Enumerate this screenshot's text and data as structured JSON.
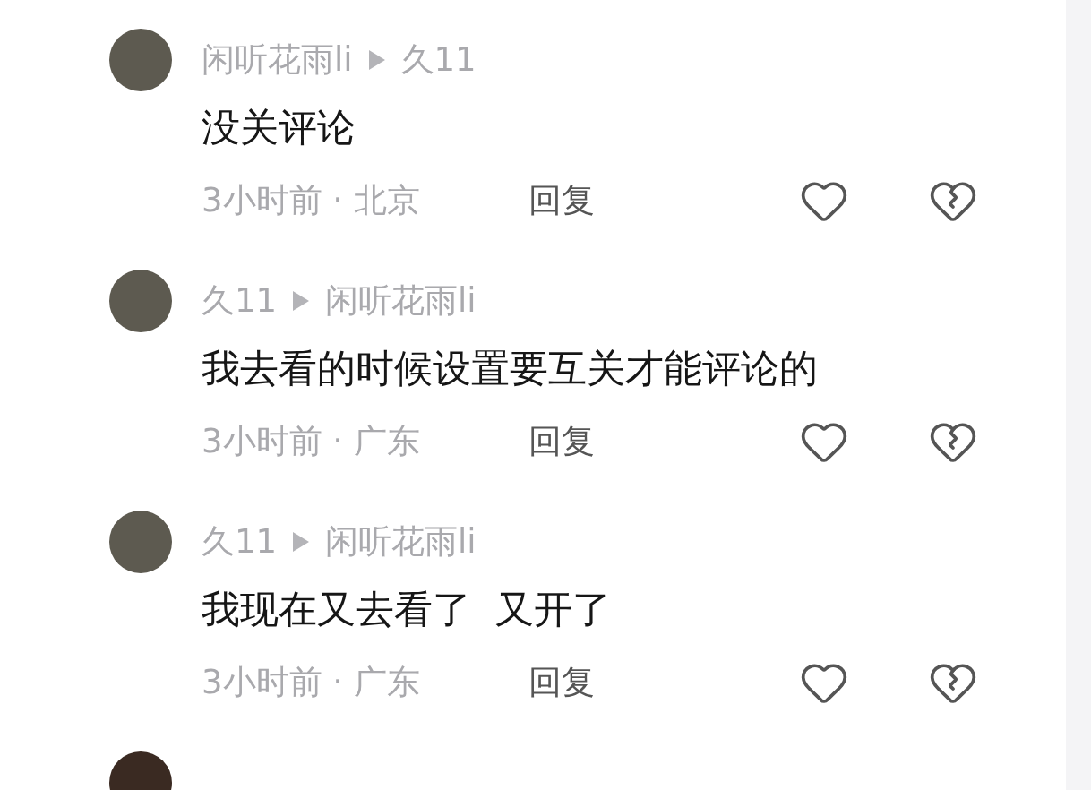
{
  "comments": [
    {
      "kind": "full",
      "author": "闲听花雨li",
      "reply_to": "久11",
      "text": "没关评论",
      "time": "3小时前",
      "separator": "·",
      "location": "北京",
      "reply": "回复",
      "liked": false,
      "disliked": false
    },
    {
      "kind": "full",
      "author": "久11",
      "reply_to": "闲听花雨li",
      "text": "我去看的时候设置要互关才能评论的",
      "time": "3小时前",
      "separator": "·",
      "location": "广东",
      "reply": "回复",
      "liked": false,
      "disliked": false
    },
    {
      "kind": "full",
      "author": "久11",
      "reply_to": "闲听花雨li",
      "text": "我现在又去看了  又开了",
      "time": "3小时前",
      "separator": "·",
      "location": "广东",
      "reply": "回复",
      "liked": false,
      "disliked": false
    },
    {
      "kind": "avatar_only"
    }
  ]
}
